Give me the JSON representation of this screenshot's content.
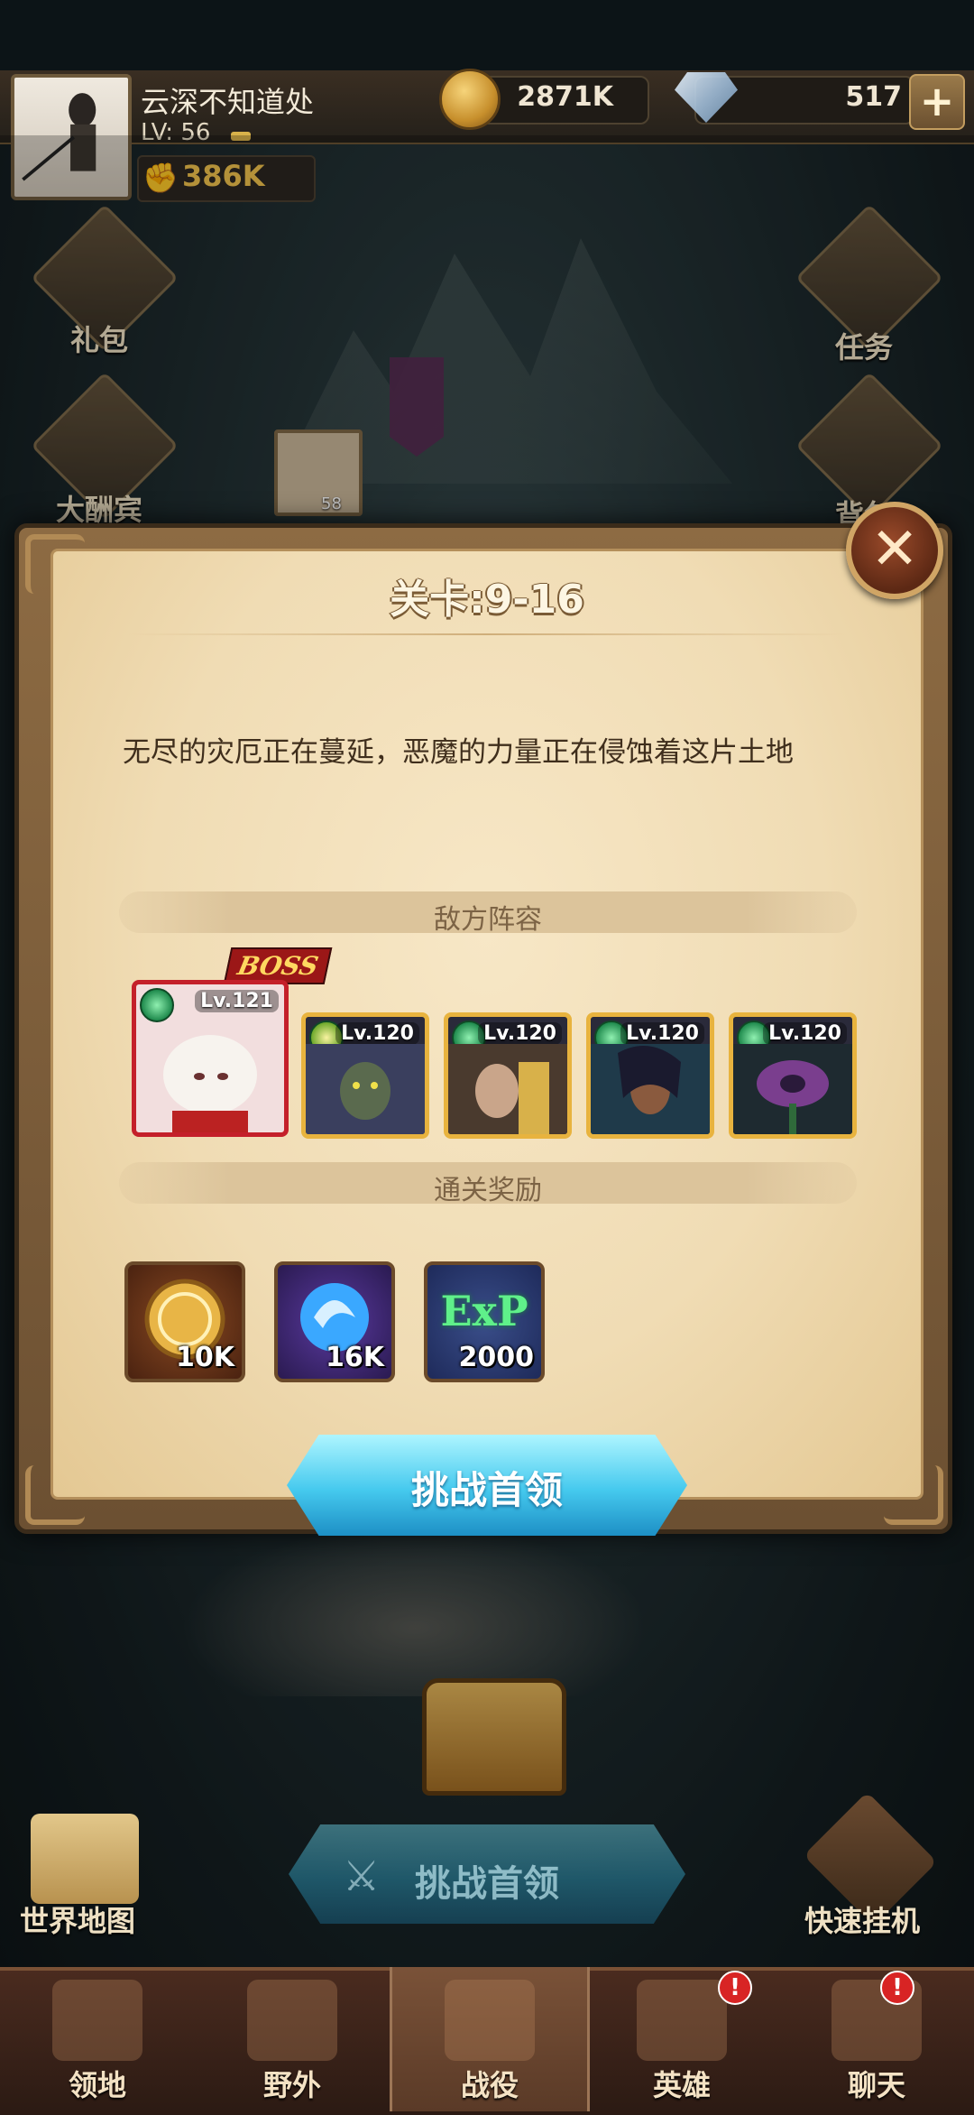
{
  "player": {
    "name": "云深不知道处",
    "level_label": "LV: 56",
    "power": "386K"
  },
  "resources": {
    "gold": "2871K",
    "gems": "517"
  },
  "left_menu": [
    {
      "label": "礼包"
    },
    {
      "label": "大酬宾"
    }
  ],
  "right_menu": [
    {
      "label": "任务"
    },
    {
      "label": "背包"
    }
  ],
  "friend": {
    "level": "58"
  },
  "dialog": {
    "title": "关卡:9-16",
    "description": "无尽的灾厄正在蔓延，恶魔的力量正在侵蚀着这片土地",
    "enemy_section": "敌方阵容",
    "boss_tag": "BOSS",
    "enemies": [
      {
        "level": "Lv.121",
        "faction": "forest",
        "boss": true
      },
      {
        "level": "Lv.120",
        "faction": "light",
        "boss": false
      },
      {
        "level": "Lv.120",
        "faction": "forest",
        "boss": false
      },
      {
        "level": "Lv.120",
        "faction": "forest",
        "boss": false
      },
      {
        "level": "Lv.120",
        "faction": "forest",
        "boss": false
      }
    ],
    "reward_section": "通关奖励",
    "rewards": [
      {
        "type": "gold-coin",
        "amount": "10K"
      },
      {
        "type": "hero-exp-orb",
        "amount": "16K"
      },
      {
        "type": "exp",
        "label": "ExP",
        "amount": "2000"
      }
    ],
    "challenge_button": "挑战首领"
  },
  "battle": {
    "challenge_button": "挑战首领",
    "world_map": "世界地图",
    "quick_idle": "快速挂机"
  },
  "nav": [
    {
      "label": "领地",
      "badge": false
    },
    {
      "label": "野外",
      "badge": false
    },
    {
      "label": "战役",
      "badge": false,
      "active": true
    },
    {
      "label": "英雄",
      "badge": true
    },
    {
      "label": "聊天",
      "badge": true
    }
  ],
  "colors": {
    "accent_cyan": "#45c9ee",
    "gold_text": "#f0c24d",
    "boss_red": "#c4202a",
    "frame_gold": "#e8b33e"
  }
}
